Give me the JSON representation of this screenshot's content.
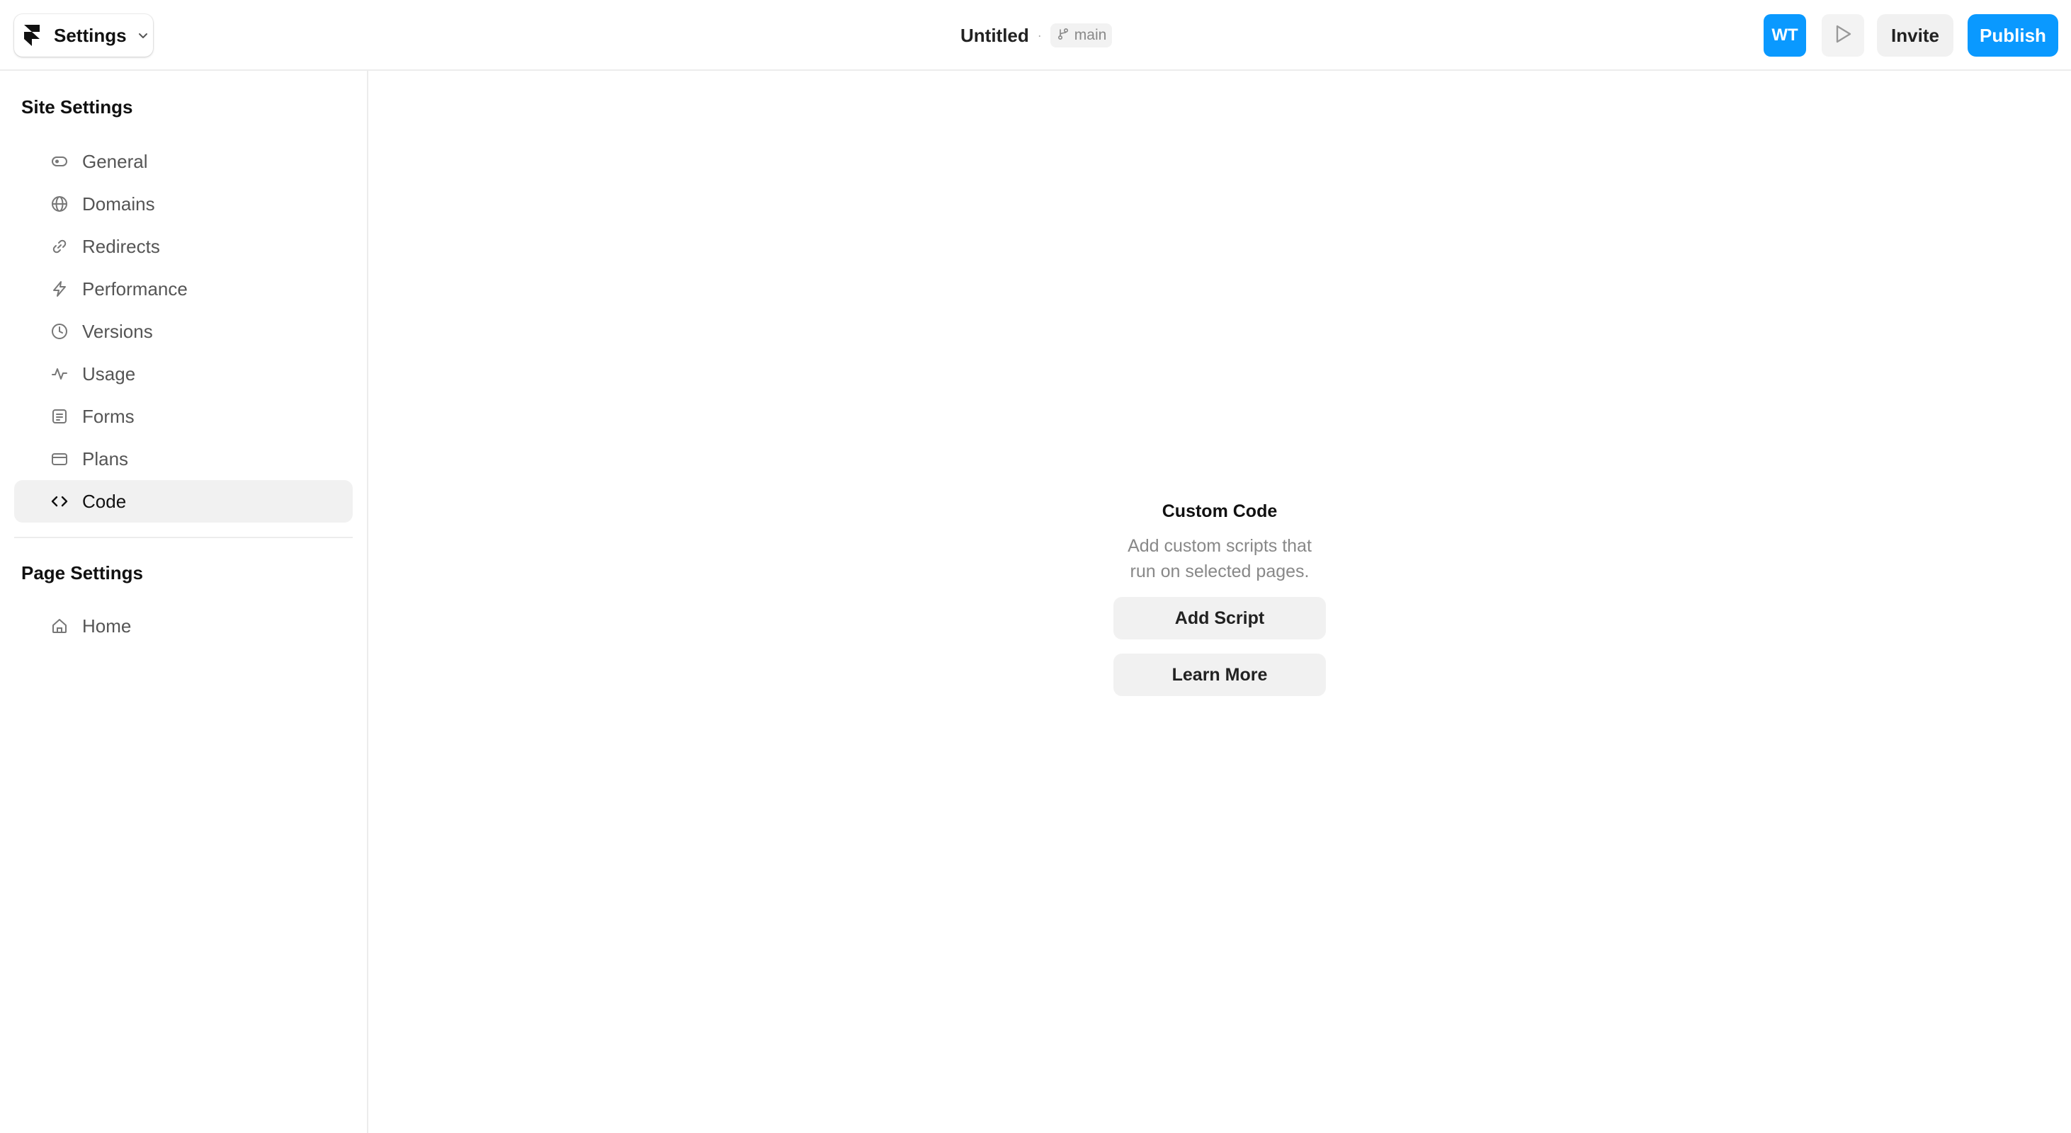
{
  "topbar": {
    "menu_label": "Settings",
    "project_title": "Untitled",
    "separator": "·",
    "branch_name": "main",
    "avatar_initials": "WT",
    "invite_label": "Invite",
    "publish_label": "Publish"
  },
  "sidebar": {
    "site_settings_title": "Site Settings",
    "site_items": [
      {
        "label": "General",
        "icon": "toggle-icon"
      },
      {
        "label": "Domains",
        "icon": "globe-icon"
      },
      {
        "label": "Redirects",
        "icon": "link-icon"
      },
      {
        "label": "Performance",
        "icon": "bolt-icon"
      },
      {
        "label": "Versions",
        "icon": "clock-icon"
      },
      {
        "label": "Usage",
        "icon": "activity-icon"
      },
      {
        "label": "Forms",
        "icon": "form-icon"
      },
      {
        "label": "Plans",
        "icon": "card-icon"
      },
      {
        "label": "Code",
        "icon": "code-icon",
        "active": true
      }
    ],
    "page_settings_title": "Page Settings",
    "page_items": [
      {
        "label": "Home",
        "icon": "home-icon"
      }
    ]
  },
  "main": {
    "empty_title": "Custom Code",
    "empty_description": "Add custom scripts that run on selected pages.",
    "add_script_label": "Add Script",
    "learn_more_label": "Learn More"
  },
  "colors": {
    "accent": "#0a99ff",
    "active_item_bg": "#f1f1f1",
    "border": "#ececec"
  }
}
